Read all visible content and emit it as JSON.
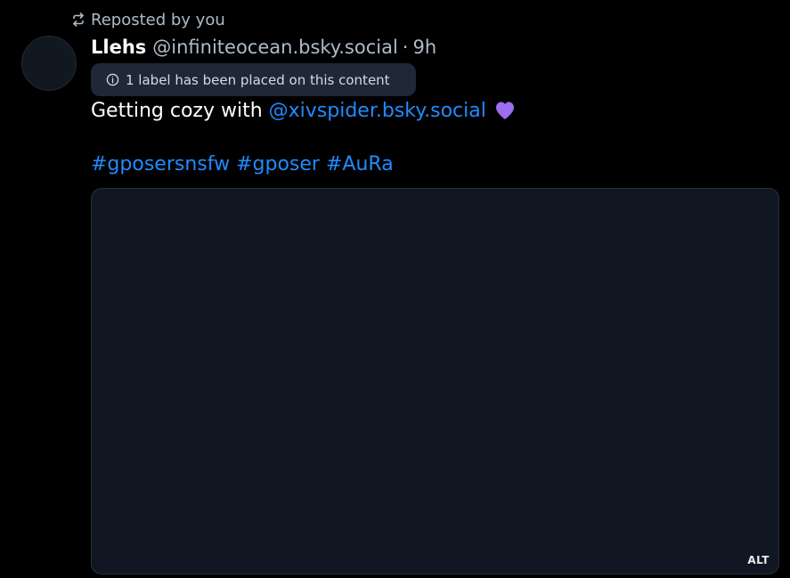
{
  "repost": {
    "text": "Reposted by you",
    "icon": "repost-icon"
  },
  "author": {
    "name": "Llehs",
    "handle": "@infiniteocean.bsky.social",
    "separator": "·",
    "time": "9h"
  },
  "label_notice": {
    "text": "1 label has been placed on this content",
    "icon": "info-icon"
  },
  "post": {
    "text_before": "Getting cozy with",
    "mention": "@xivspider.bsky.social",
    "emoji": "purple-heart",
    "hashtags": [
      "#gposersnsfw",
      "#gposer",
      "#AuRa"
    ]
  },
  "media": {
    "alt_badge": "ALT"
  },
  "colors": {
    "background": "#000000",
    "link": "#208bfe",
    "muted_text": "#aebbc9",
    "heart": "#9b6ff0",
    "media_bg": "#111722"
  }
}
